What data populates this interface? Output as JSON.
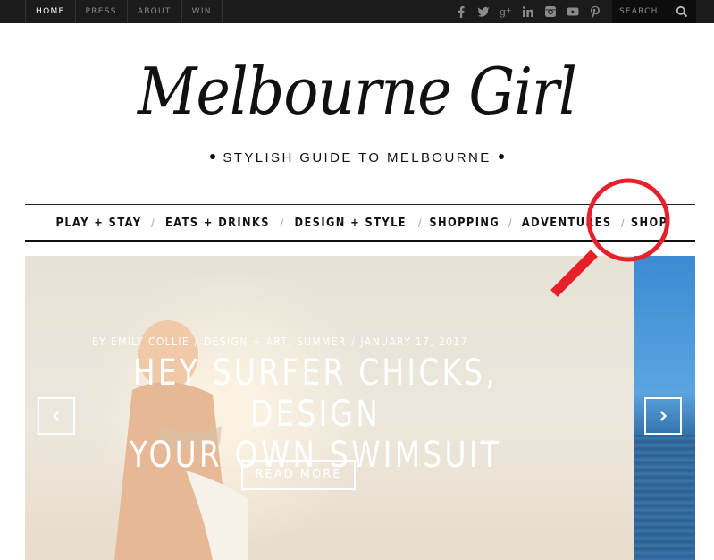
{
  "topbar": {
    "nav": [
      "HOME",
      "PRESS",
      "ABOUT",
      "WIN"
    ],
    "socials": [
      "facebook-icon",
      "twitter-icon",
      "google-plus-icon",
      "linkedin-icon",
      "instagram-icon",
      "youtube-icon",
      "pinterest-icon"
    ],
    "search_placeholder": "SEARCH"
  },
  "brand": {
    "logo": "Melbourne Girl",
    "tagline": "STYLISH GUIDE TO MELBOURNE"
  },
  "mainnav": [
    "PLAY + STAY",
    "EATS + DRINKS",
    "DESIGN + STYLE",
    "SHOPPING",
    "ADVENTURES",
    "SHOP"
  ],
  "slide": {
    "author": "BY EMILY COLLIE",
    "categories": "DESIGN + ART, SUMMER",
    "date": "JANUARY 17, 2017",
    "title_line1": "HEY SURFER CHICKS, DESIGN",
    "title_line2": "YOUR OWN SWIMSUIT",
    "read_more": "READ MORE"
  },
  "colors": {
    "topbar": "#1b1b1b",
    "annotation": "#e8202a"
  }
}
